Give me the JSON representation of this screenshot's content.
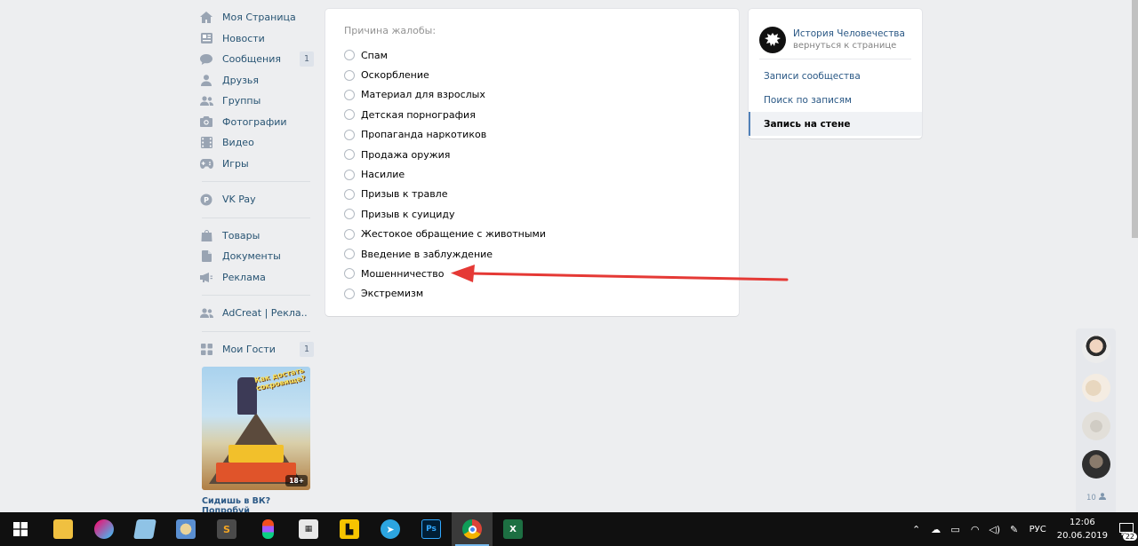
{
  "sidebar": {
    "items": [
      {
        "label": "Моя Страница",
        "icon": "home-icon"
      },
      {
        "label": "Новости",
        "icon": "news-icon"
      },
      {
        "label": "Сообщения",
        "icon": "messages-icon",
        "badge": "1"
      },
      {
        "label": "Друзья",
        "icon": "friends-icon"
      },
      {
        "label": "Группы",
        "icon": "groups-icon"
      },
      {
        "label": "Фотографии",
        "icon": "photos-icon"
      },
      {
        "label": "Видео",
        "icon": "video-icon"
      },
      {
        "label": "Игры",
        "icon": "games-icon"
      }
    ],
    "vkpay": {
      "label": "VK Pay",
      "icon": "vkpay-icon"
    },
    "items2": [
      {
        "label": "Товары",
        "icon": "goods-icon"
      },
      {
        "label": "Документы",
        "icon": "docs-icon"
      },
      {
        "label": "Реклама",
        "icon": "ads-icon"
      }
    ],
    "adcreat": {
      "label": "AdCreat | Рекла..",
      "icon": "users-icon"
    },
    "guests": {
      "label": "Мои Гости",
      "icon": "apps-icon",
      "badge": "1"
    },
    "promo": {
      "image_text": "Как достать сокровище?",
      "age": "18+",
      "caption": "Сидишь в ВК? Попробуй"
    }
  },
  "report": {
    "header": "Причина жалобы:",
    "reasons": [
      "Спам",
      "Оскорбление",
      "Материал для взрослых",
      "Детская порнография",
      "Пропаганда наркотиков",
      "Продажа оружия",
      "Насилие",
      "Призыв к травле",
      "Призыв к суициду",
      "Жестокое обращение с животными",
      "Введение в заблуждение",
      "Мошенничество",
      "Экстремизм"
    ],
    "arrow_color": "#e53935"
  },
  "community": {
    "name": "История Человечества",
    "back_link": "вернуться к странице",
    "menu": [
      {
        "label": "Записи сообщества",
        "active": false
      },
      {
        "label": "Поиск по записям",
        "active": false
      },
      {
        "label": "Запись на стене",
        "active": true
      }
    ]
  },
  "chats": {
    "count": "10"
  },
  "taskbar": {
    "lang": "РУС",
    "time": "12:06",
    "date": "20.06.2019",
    "notifications": "22"
  },
  "colors": {
    "link": "#2a5885",
    "accent": "#5181b8",
    "background": "#edeef0"
  }
}
